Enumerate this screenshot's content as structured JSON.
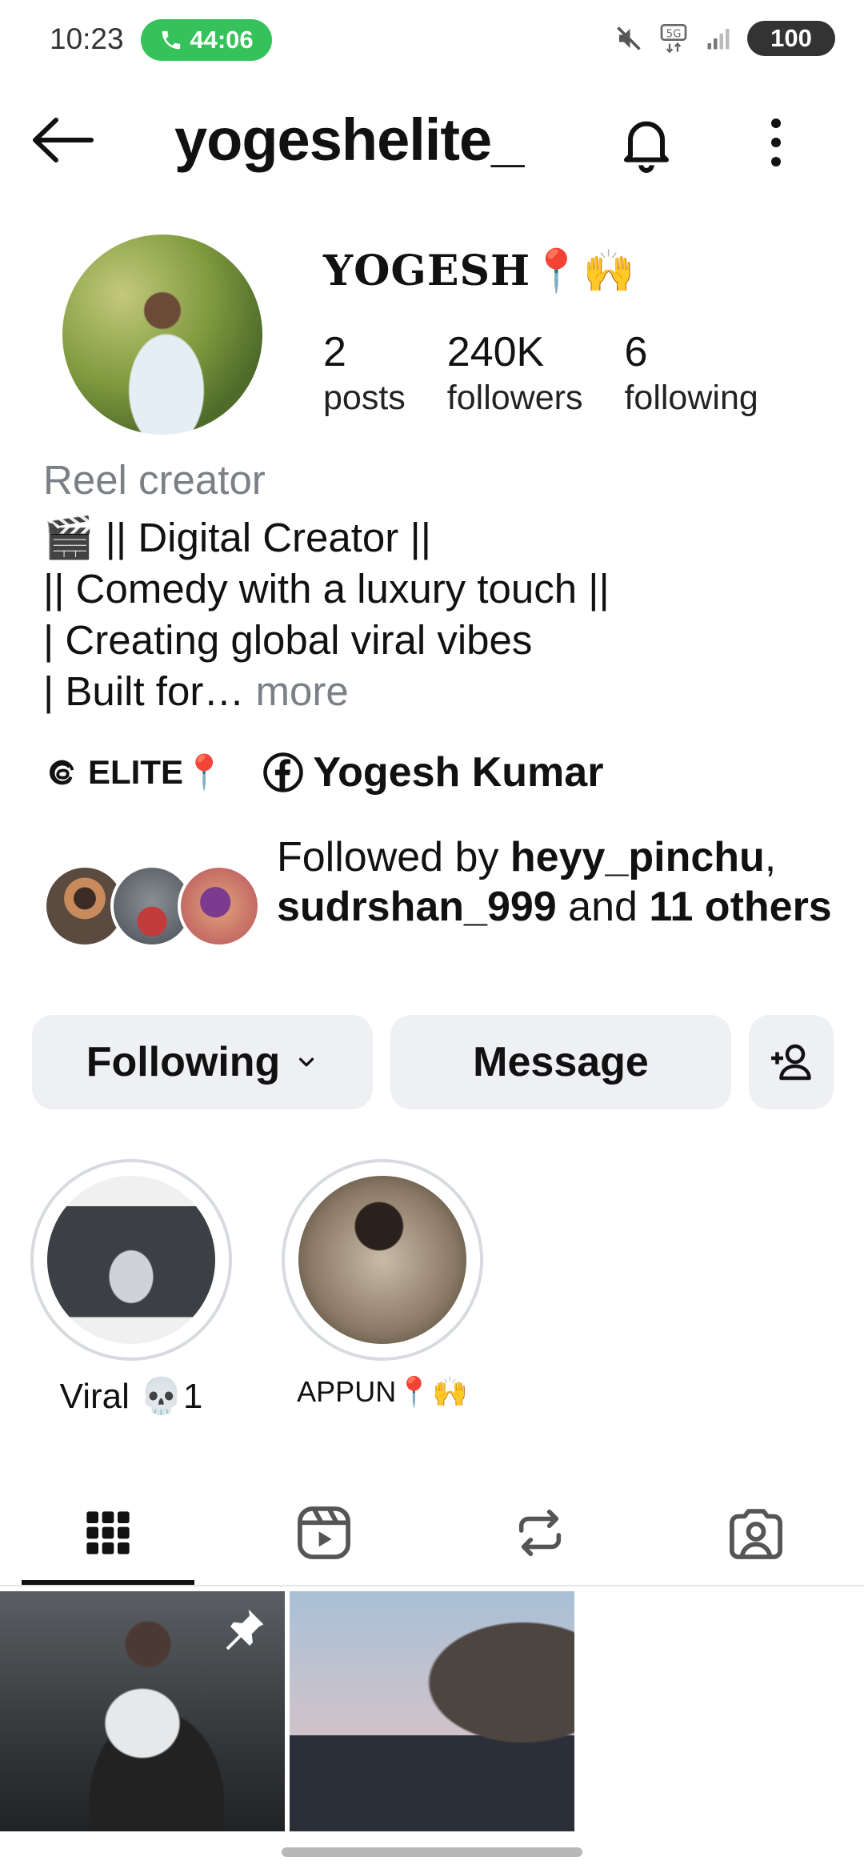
{
  "status_bar": {
    "time": "10:23",
    "call_duration": "44:06",
    "network": "5G",
    "battery": "100"
  },
  "header": {
    "username": "yogeshelite_",
    "icons": [
      "back-arrow-icon",
      "bell-icon",
      "more-vertical-icon"
    ]
  },
  "profile": {
    "display_name": "YOGESH📍🙌",
    "stats": [
      {
        "value": "2",
        "label": "posts"
      },
      {
        "value": "240K",
        "label": "followers"
      },
      {
        "value": "6",
        "label": "following"
      }
    ],
    "category": "Reel creator",
    "bio_lines": [
      "🎬 || Digital Creator ||",
      "|| Comedy with a luxury touch ||",
      "| Creating global viral vibes",
      "| Built for…"
    ],
    "bio_more": " more",
    "links": {
      "threads": "ELITE📍",
      "facebook": "Yogesh Kumar"
    },
    "followed_by": {
      "prefix": "Followed by ",
      "user1": "heyy_pinchu",
      "sep": ", ",
      "user2": "sudrshan_999",
      "and": " and ",
      "others": "11 others"
    }
  },
  "actions": {
    "following_label": "Following",
    "message_label": "Message"
  },
  "highlights": [
    {
      "label": "Viral 💀1"
    },
    {
      "label": "APPUN📍🙌"
    }
  ],
  "tabs": [
    "grid-icon",
    "reels-icon",
    "reposts-icon",
    "tagged-icon"
  ],
  "colors": {
    "call_pill": "#36c25a",
    "button_bg": "#eef0f4",
    "muted_text": "#7b7f86"
  }
}
